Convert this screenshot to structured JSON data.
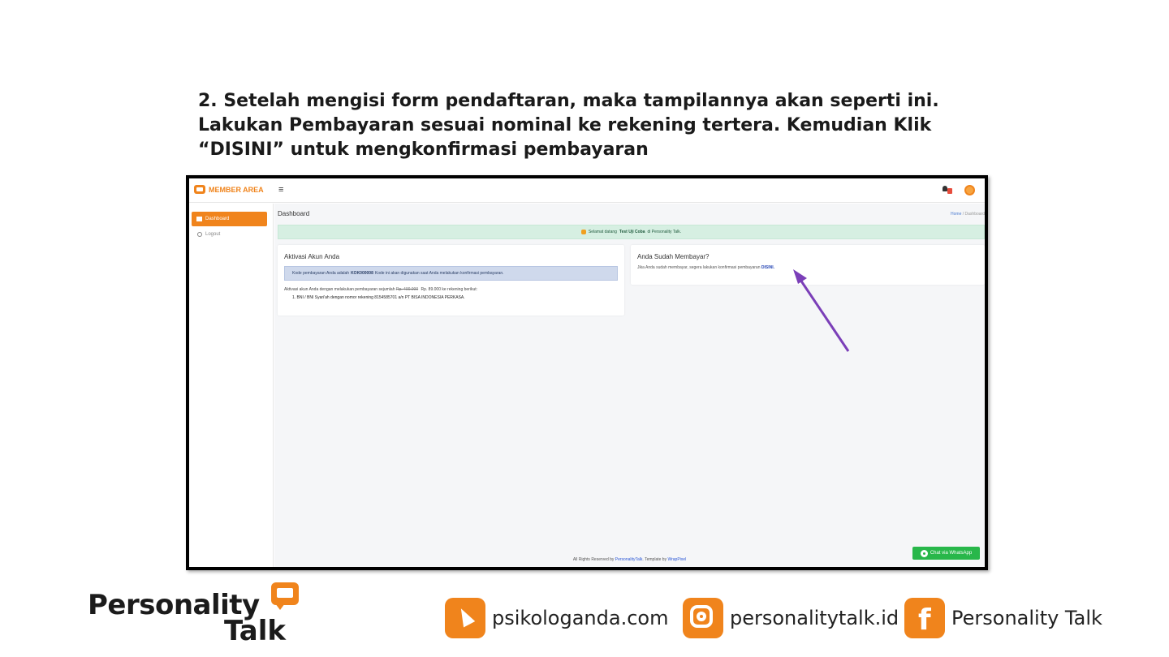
{
  "instruction": {
    "line1": "2. Setelah mengisi form pendaftaran, maka tampilannya akan seperti ini.",
    "line2": "Lakukan Pembayaran sesuai nominal ke rekening tertera. Kemudian Klik",
    "line3": "“DISINI” untuk mengkonfirmasi pembayaran"
  },
  "app": {
    "brand": "MEMBER AREA",
    "menu_icon": "hamburger-icon",
    "sidebar": {
      "active_item": "Dashboard",
      "logout": "Logout"
    },
    "page_title": "Dashboard",
    "breadcrumb": {
      "home": "Home",
      "separator": "/",
      "current": "Dashboard"
    },
    "alert": {
      "prefix": "Selamat datang",
      "name": "Test Uji Coba",
      "suffix": "di Personality Talk."
    },
    "activation_card": {
      "title": "Aktivasi Akun Anda",
      "code_prefix": "Kode pembayaran Anda adalah",
      "code": "KOK000008",
      "code_suffix": "Kode ini akan digunakan saat Anda melakukan konfirmasi pembayaran.",
      "pay_prefix": "Aktivasi akun Anda dengan melakukan pembayaran sejumlah",
      "old_price": "Rp. 400.000",
      "price": "Rp. 89.000",
      "pay_suffix": "ke rekening berikut:",
      "bank_line": "1. BNI / BNI Syari'ah dengan nomor rekening 8154585701 a/n PT BISA INDONESIA PERKASA."
    },
    "confirm_card": {
      "title": "Anda Sudah Membayar?",
      "text": "Jika Anda sudah membayar, segera lakukan konfirmasi pembayaran",
      "link": "DISINI."
    },
    "footer": {
      "prefix": "All Rights Reserved by",
      "brand_link": "PersonalityTalk",
      "middle": ". Template by",
      "template_link": "WrapPixel"
    },
    "whatsapp": "Chat via WhatsApp"
  },
  "branding": {
    "logo_line1": "Personality",
    "logo_line2": "Talk",
    "website": "psikologanda.com",
    "instagram": "personalitytalk.id",
    "facebook": "Personality Talk",
    "fb_letter": "f"
  },
  "colors": {
    "accent": "#f0841c",
    "annotation_arrow": "#7b3fb8",
    "whatsapp": "#28b74a",
    "alert_bg": "#d6efe2",
    "info_bg": "#cfd9ec"
  }
}
